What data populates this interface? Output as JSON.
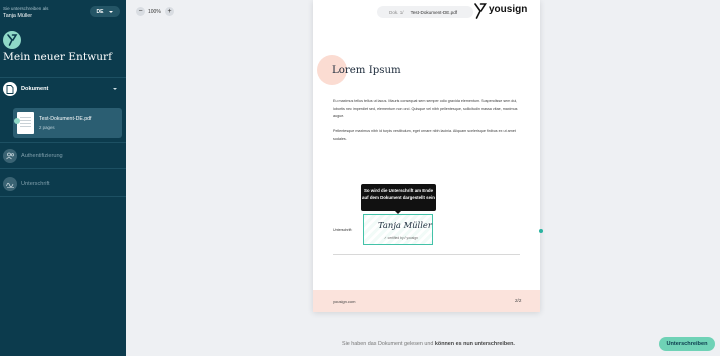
{
  "sidebar": {
    "signer_caption": "Sie unterschreiben als",
    "signer_name": "Tanja Müller",
    "language": "DE",
    "draft_title": "Mein neuer Entwurf",
    "steps": [
      {
        "label": "Dokument",
        "icon": "document-icon",
        "state": "active"
      },
      {
        "label": "Authentifizierung",
        "icon": "people-icon",
        "state": "pending"
      },
      {
        "label": "Unterschrift",
        "icon": "signature-icon",
        "state": "pending"
      }
    ],
    "document": {
      "name": "Test-Dokument-DE.pdf",
      "pages": "2 pages"
    }
  },
  "toolbar": {
    "zoom_minus": "−",
    "zoom_value": "100%",
    "zoom_plus": "+"
  },
  "page": {
    "doc_prefix": "Dok. 1/",
    "doc_name": "Test-Dokument-DE.pdf",
    "brand": "yousign",
    "heading": "Lorem Ipsum",
    "paragraph_1": "Eu maximus tellus tellus ut lacus. Mauris consequat sem semper odio gravida elementum. Suspendisse sem dui, lobortis nec imperdiet sed, elementum non orci. Quisque vel nibh pellentesque, sollicitudin massa vitae, maximus augue.",
    "paragraph_2": "Pellentesque maximus nibh id turpis vestibulum, eget ornare nibh lacinia. Aliquam scelerisque finibus ex ut amet sodales.",
    "signature_label": "Unterschrift:",
    "signature_script": "Tanja Müller",
    "signature_certified": "✓ certified by ⁄⁄ yousign",
    "footer_url": "yousign.com",
    "page_number": "2/2"
  },
  "tooltip": "So wird die Unterschrift am Ende auf dem Dokument dargestellt sein",
  "footer": {
    "prefix": "Sie haben das Dokument gelesen und",
    "emphasis": "können es nun unterschreiben.",
    "sign_button": "Unterschreiben"
  },
  "colors": {
    "sidebar": "#0c3b4d",
    "accent": "#6fd2b6",
    "signature_border": "#43c2a8",
    "footer_pink": "#fbe3dc"
  }
}
